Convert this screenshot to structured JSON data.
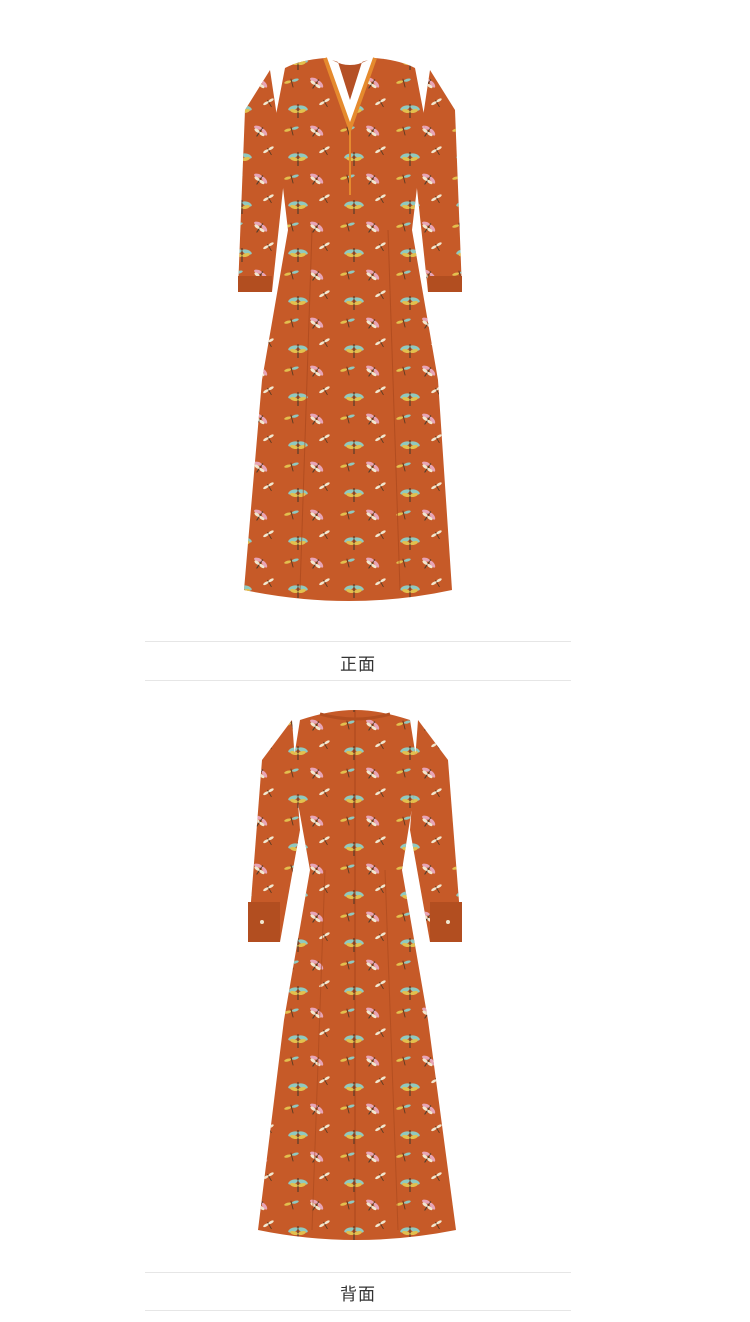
{
  "colors": {
    "dress_base": "#c65a28",
    "dress_shadow": "#a9471d",
    "trim": "#e58a2e",
    "print_teal": "#8fc9c0",
    "print_yellow": "#e2c04e",
    "print_pink": "#e7a4b6",
    "print_cream": "#f1e7cf",
    "background": "#ffffff"
  },
  "front": {
    "caption": "正面"
  },
  "back": {
    "caption": "背面"
  }
}
